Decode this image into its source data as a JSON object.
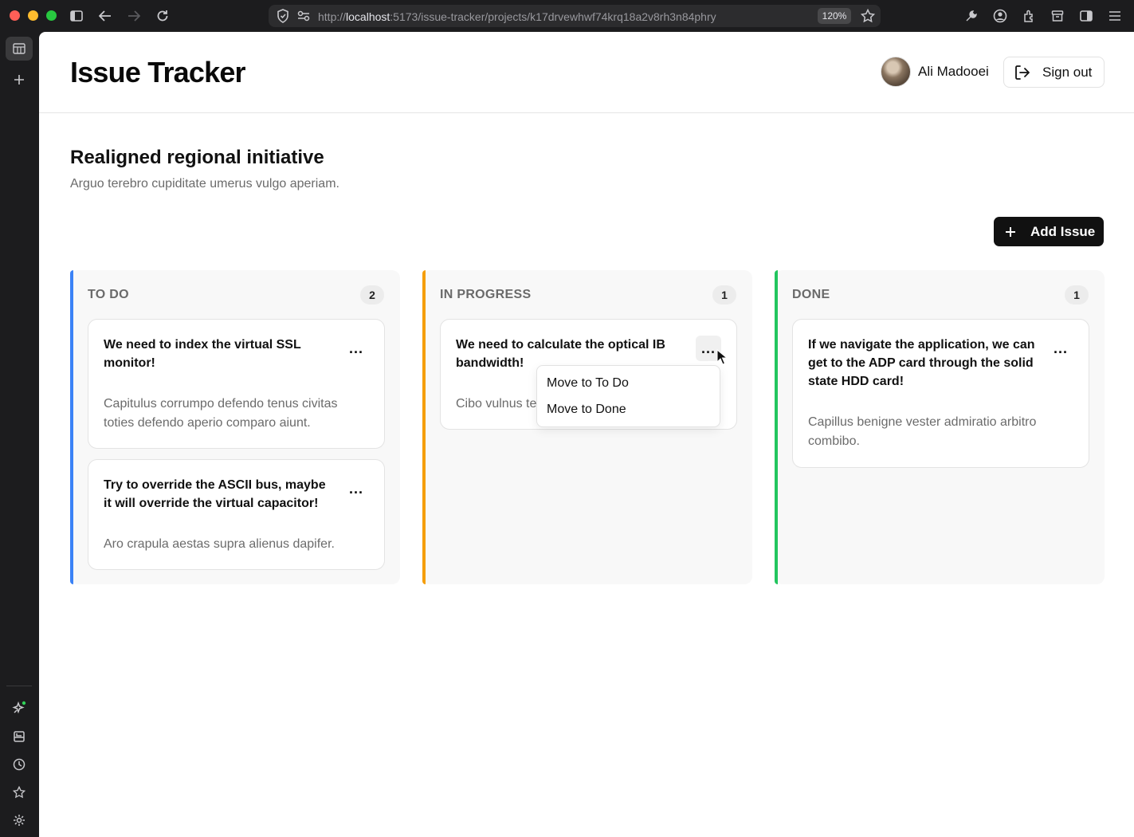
{
  "browser": {
    "url_prefix": "http://",
    "url_host": "localhost",
    "url_path": ":5173/issue-tracker/projects/k17drvewhwf74krq18a2v8rh3n84phry",
    "zoom": "120%"
  },
  "header": {
    "title": "Issue Tracker",
    "user_name": "Ali Madooei",
    "sign_out_label": "Sign out"
  },
  "project": {
    "title": "Realigned regional initiative",
    "description": "Arguo terebro cupiditate umerus vulgo aperiam.",
    "add_issue_label": "Add Issue"
  },
  "columns": [
    {
      "title": "TO DO",
      "count": "2",
      "accent": "#3b82f6",
      "cards": [
        {
          "title": "We need to index the virtual SSL monitor!",
          "description": "Capitulus corrumpo defendo tenus civitas toties defendo aperio comparo aiunt.",
          "menu": "..."
        },
        {
          "title": "Try to override the ASCII bus, maybe it will override the virtual capacitor!",
          "description": "Aro crapula aestas supra alienus dapifer.",
          "menu": "..."
        }
      ]
    },
    {
      "title": "IN PROGRESS",
      "count": "1",
      "accent": "#f59e0b",
      "cards": [
        {
          "title": "We need to calculate the optical IB bandwidth!",
          "description": "Cibo vulnus te",
          "menu": "..."
        }
      ]
    },
    {
      "title": "DONE",
      "count": "1",
      "accent": "#22c55e",
      "cards": [
        {
          "title": "If we navigate the application, we can get to the ADP card through the solid state HDD card!",
          "description": "Capillus benigne vester admiratio arbitro combibo.",
          "menu": "..."
        }
      ]
    }
  ],
  "dropdown": {
    "items": [
      "Move to To Do",
      "Move to Done"
    ]
  }
}
